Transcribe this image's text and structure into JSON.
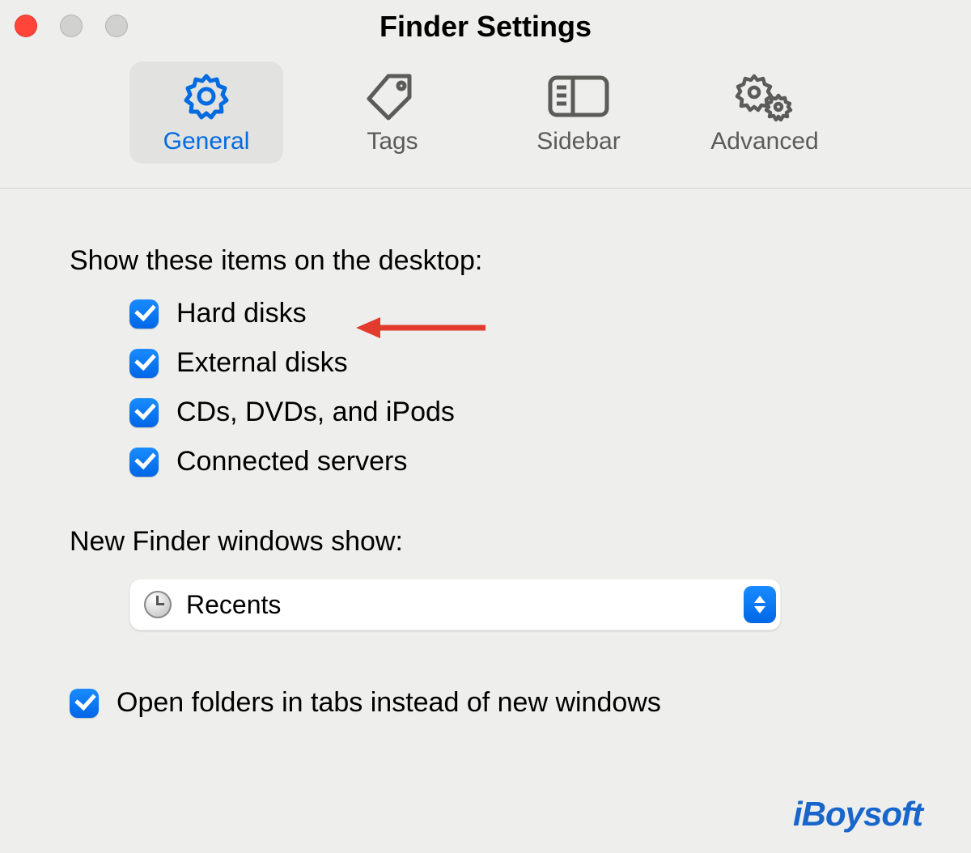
{
  "window": {
    "title": "Finder Settings"
  },
  "tabs": {
    "general": "General",
    "tags": "Tags",
    "sidebar": "Sidebar",
    "advanced": "Advanced"
  },
  "desktop_section": {
    "heading": "Show these items on the desktop:",
    "items": {
      "hard_disks": {
        "label": "Hard disks",
        "checked": true
      },
      "external": {
        "label": "External disks",
        "checked": true
      },
      "cds": {
        "label": "CDs, DVDs, and iPods",
        "checked": true
      },
      "servers": {
        "label": "Connected servers",
        "checked": true
      }
    }
  },
  "new_windows_section": {
    "heading": "New Finder windows show:",
    "selected": "Recents"
  },
  "open_in_tabs": {
    "label": "Open folders in tabs instead of new windows",
    "checked": true
  },
  "watermark": "iBoysoft"
}
